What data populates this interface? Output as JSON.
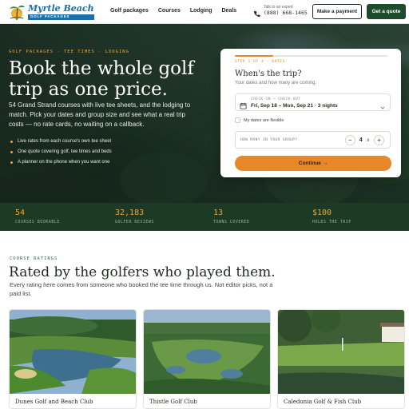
{
  "brand": {
    "title": "Myrtle Beach",
    "subtitle": "GOLF PACKAGES"
  },
  "nav": {
    "links": [
      "Golf packages",
      "Courses",
      "Lodging",
      "Deals"
    ],
    "phone_caption": "Talk to an expert",
    "phone_number": "(888) 668-1465",
    "payment_button": "Make a payment",
    "quote_button": "Get a quote"
  },
  "hero": {
    "kicker": "GOLF PACKAGES · TEE TIMES · LODGING",
    "title": "Book the whole golf trip as one price.",
    "description": "54 Grand Strand courses with live tee sheets, and the lodging to match. Pick your dates and group size and see what a real trip costs — no rate cards, no waiting on a callback.",
    "bullets": [
      "Live rates from each course's own tee sheet",
      "One quote covering golf, tee times and beds",
      "A planner on the phone when you want one"
    ]
  },
  "form": {
    "step": "STEP 1 OF 4 · DATES",
    "progress": 0.25,
    "title": "When's the trip?",
    "subtitle": "Your dates and how many are coming.",
    "date_label": "CHECK-IN → CHECK-OUT",
    "date_value": "Fri, Sep 18 – Mon, Sep 21 · 3 nights",
    "flexible_label": "My dates are flexible",
    "flexible_checked": false,
    "group_label": "HOW MANY IN YOUR GROUP?",
    "group_minus": "−",
    "group_value": "4",
    "group_caret": "∧",
    "group_plus": "+",
    "continue_label": "Continue →"
  },
  "stats": [
    {
      "value": "54",
      "label": "COURSES BOOKABLE"
    },
    {
      "value": "32,183",
      "label": "GOLFER REVIEWS"
    },
    {
      "value": "13",
      "label": "TOWNS COVERED"
    },
    {
      "value": "$100",
      "label": "HOLDS THE TRIP"
    }
  ],
  "ratings": {
    "kicker": "COURSE RATINGS",
    "title": "Rated by the golfers who played them.",
    "description": "Every rating here comes from someone who booked the tee time through us. Not editor picks, not a paid list.",
    "courses": [
      {
        "name": "Dunes Golf and Beach Club"
      },
      {
        "name": "Thistle Golf Club"
      },
      {
        "name": "Caledonia Golf & Fish Club"
      }
    ]
  },
  "colors": {
    "accent": "#e8862a",
    "brand_green": "#1f4a2c",
    "stats_bg": "#1d3a25",
    "stat_value": "#e8a23a",
    "logo_blue": "#1e6ea8"
  }
}
